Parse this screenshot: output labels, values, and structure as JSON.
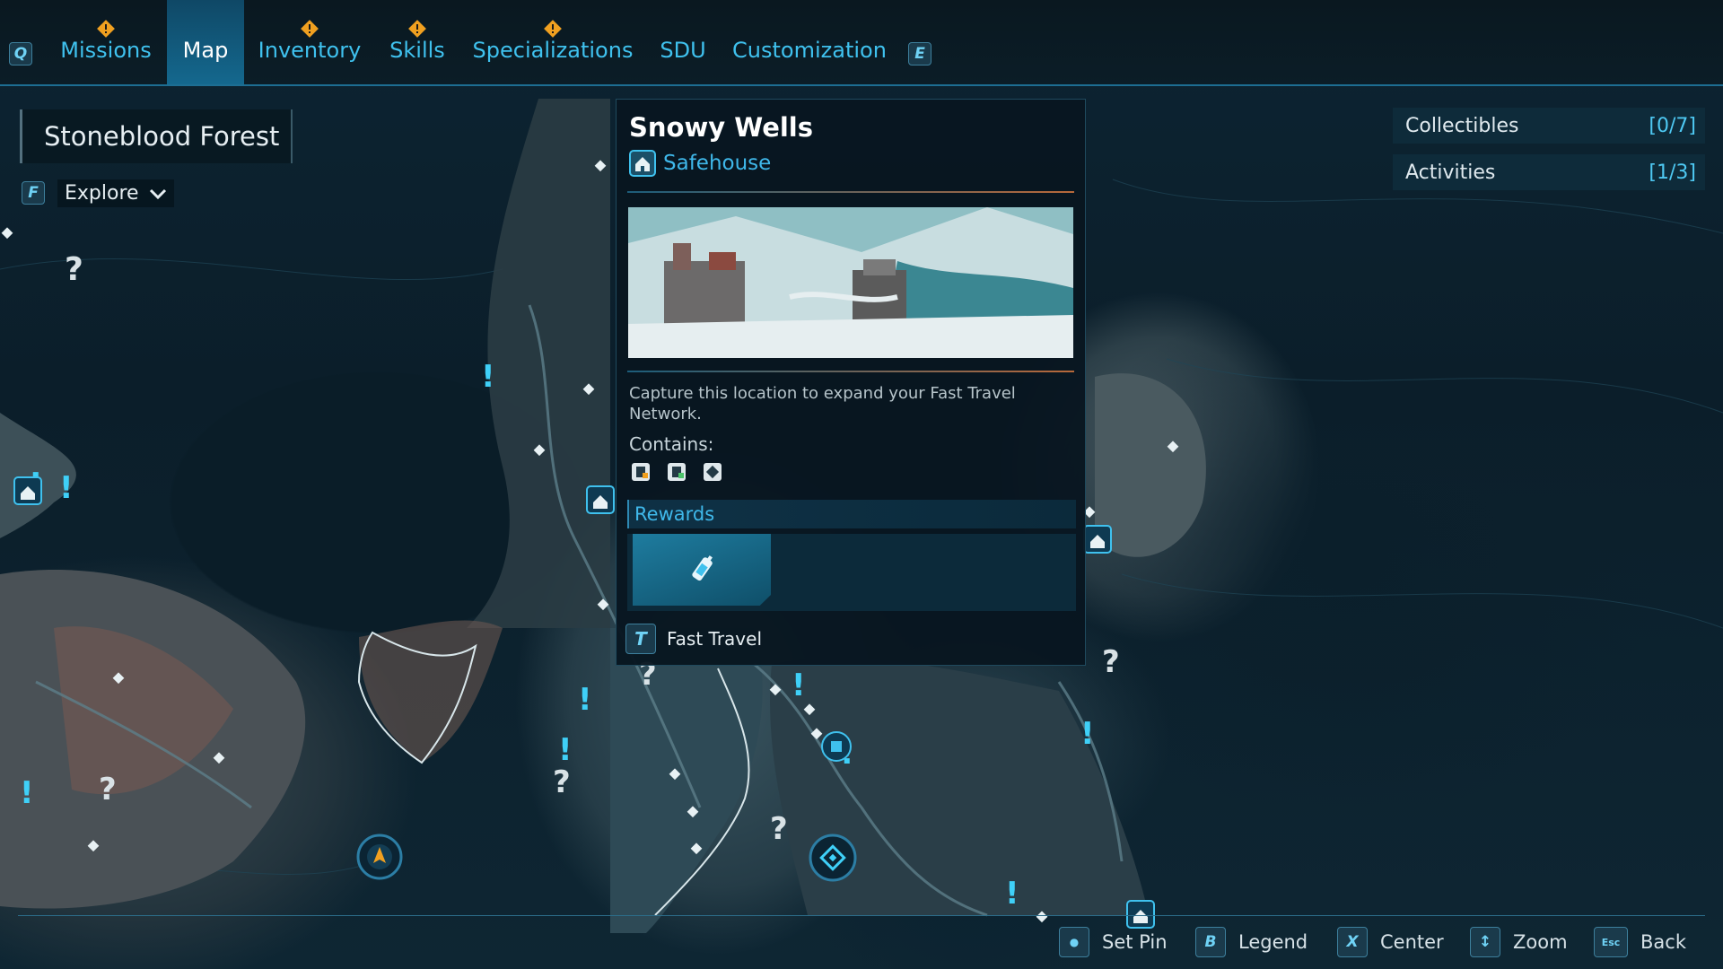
{
  "hud": {
    "tabs": [
      {
        "label": "Missions",
        "alert": true
      },
      {
        "label": "Map",
        "alert": false,
        "active": true
      },
      {
        "label": "Inventory",
        "alert": true
      },
      {
        "label": "Skills",
        "alert": true
      },
      {
        "label": "Specializations",
        "alert": true
      },
      {
        "label": "SDU",
        "alert": false
      },
      {
        "label": "Customization",
        "alert": false
      }
    ],
    "prev_key": "Q",
    "next_key": "E"
  },
  "region": {
    "name": "Stoneblood Forest",
    "explore_key": "F",
    "explore_label": "Explore"
  },
  "tracker": [
    {
      "label": "Collectibles",
      "count": "[0/7]"
    },
    {
      "label": "Activities",
      "count": "[1/3]"
    }
  ],
  "location_card": {
    "title": "Snowy Wells",
    "type": "Safehouse",
    "description": "Capture this location to expand your Fast Travel Network.",
    "contains_label": "Contains:",
    "rewards_label": "Rewards",
    "fast_travel_key": "T",
    "fast_travel_label": "Fast Travel"
  },
  "controls": [
    {
      "key": "●",
      "label": "Set Pin"
    },
    {
      "key": "B",
      "label": "Legend"
    },
    {
      "key": "X",
      "label": "Center"
    },
    {
      "key": "↕",
      "label": "Zoom"
    },
    {
      "key": "Esc",
      "label": "Back"
    }
  ],
  "colors": {
    "accent": "#3fc1ee",
    "alert": "#f0a020",
    "player_marker": "#f0a020"
  }
}
